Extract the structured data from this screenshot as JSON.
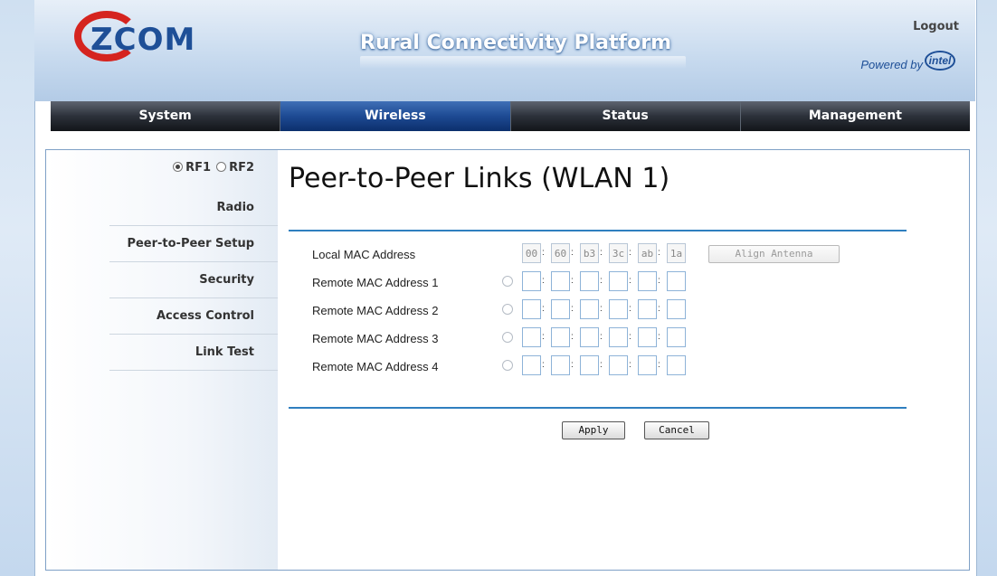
{
  "header": {
    "logo": "ZCOM",
    "title": "Rural Connectivity Platform",
    "logout": "Logout",
    "powered_by": "Powered by",
    "intel": "intel"
  },
  "nav": [
    {
      "label": "System",
      "active": false
    },
    {
      "label": "Wireless",
      "active": true
    },
    {
      "label": "Status",
      "active": false
    },
    {
      "label": "Management",
      "active": false
    }
  ],
  "sidebar": {
    "rf": [
      {
        "label": "RF1",
        "selected": true
      },
      {
        "label": "RF2",
        "selected": false
      }
    ],
    "items": [
      {
        "label": "Radio"
      },
      {
        "label": "Peer-to-Peer Setup"
      },
      {
        "label": "Security"
      },
      {
        "label": "Access Control"
      },
      {
        "label": "Link Test"
      }
    ]
  },
  "main": {
    "title": "Peer-to-Peer Links (WLAN 1)",
    "local": {
      "label": "Local MAC Address",
      "octets": [
        "00",
        "60",
        "b3",
        "3c",
        "ab",
        "1a"
      ],
      "align_button": "Align Antenna"
    },
    "remotes": [
      {
        "label": "Remote MAC Address 1",
        "octets": [
          "",
          "",
          "",
          "",
          "",
          ""
        ]
      },
      {
        "label": "Remote MAC Address 2",
        "octets": [
          "",
          "",
          "",
          "",
          "",
          ""
        ]
      },
      {
        "label": "Remote MAC Address 3",
        "octets": [
          "",
          "",
          "",
          "",
          "",
          ""
        ]
      },
      {
        "label": "Remote MAC Address 4",
        "octets": [
          "",
          "",
          "",
          "",
          "",
          ""
        ]
      }
    ],
    "apply_button": "Apply",
    "cancel_button": "Cancel"
  },
  "colors": {
    "accent": "#2f7fbf",
    "nav_active": "#1d4a93",
    "logo_red": "#d5241f",
    "logo_blue": "#1e4f97"
  }
}
